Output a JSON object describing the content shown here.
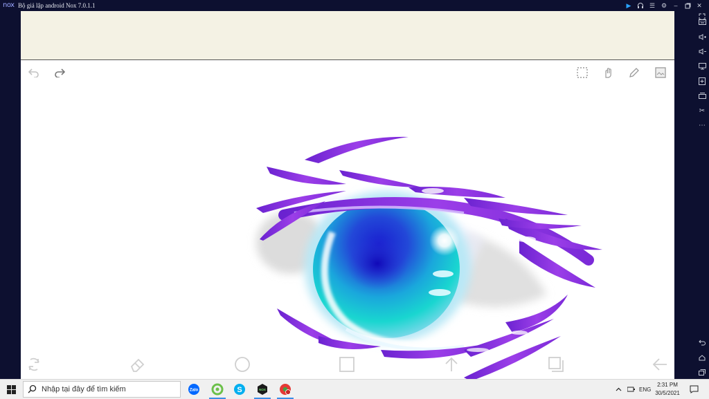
{
  "window": {
    "logo": "nox",
    "title": "Bộ giả lập android Nox 7.0.1.1",
    "controls": [
      "play-icon",
      "headset-icon",
      "menu-icon",
      "settings-icon",
      "minimize-icon",
      "restore-icon",
      "close-icon",
      "expand-icon"
    ]
  },
  "sidebar": {
    "items": [
      "keyboard-icon",
      "volume-up-icon",
      "volume-down-icon",
      "screen-icon",
      "add-apk-icon",
      "multi-instance-icon",
      "scissors-icon",
      "more-icon"
    ],
    "bottom": [
      "back-icon",
      "home-icon",
      "recents-icon"
    ]
  },
  "canvas": {
    "top_tools": [
      "undo-icon",
      "redo-icon",
      "selection-icon",
      "hand-icon",
      "pencil-icon",
      "layers-icon"
    ],
    "bottom_tools": [
      "transform-icon",
      "eraser-icon",
      "circle-icon",
      "square-icon",
      "upload-arrow-icon",
      "copy-layers-icon",
      "back-arrow-icon"
    ],
    "artwork": "anime-eye-drawing"
  },
  "taskbar": {
    "search_placeholder": "Nhập tại đây để tìm kiếm",
    "apps": [
      {
        "name": "zalo-icon",
        "label": "Zalo",
        "color": "#0068ff"
      },
      {
        "name": "green-app-icon",
        "label": "",
        "color": "#6cc04a"
      },
      {
        "name": "skype-icon",
        "label": "S",
        "color": "#00aff0"
      },
      {
        "name": "nox-icon",
        "label": "NOX",
        "color": "#1b1b1b"
      },
      {
        "name": "red-app-icon",
        "label": "",
        "color": "#e53935"
      }
    ],
    "language": "ENG",
    "time": "2:31 PM",
    "date": "30/5/2021"
  },
  "colors": {
    "accent": "#3a8ee6",
    "eye_purple": "#7b2ad8",
    "eye_teal": "#19d6d0",
    "eye_blue": "#1f3bd6"
  }
}
